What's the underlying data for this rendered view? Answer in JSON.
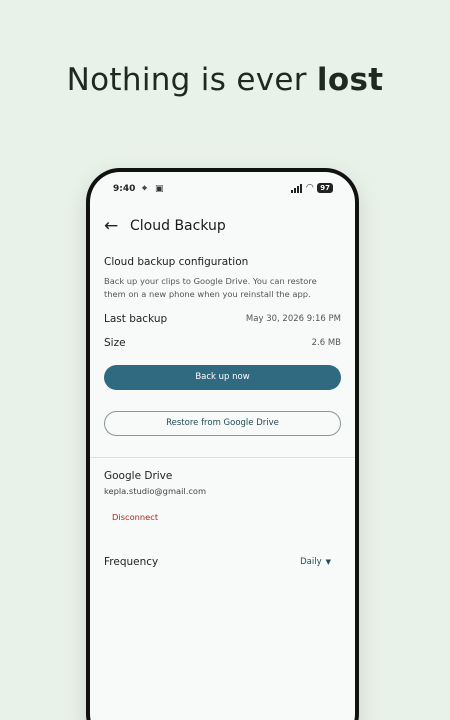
{
  "headline": {
    "prefix": "Nothing is ever ",
    "emphasis": "lost"
  },
  "status": {
    "time": "9:40",
    "battery": "97",
    "left_icons": [
      "navigation-icon",
      "sim-icon"
    ],
    "right_icons": [
      "signal-icon",
      "wifi-icon",
      "battery-icon"
    ]
  },
  "appbar": {
    "title": "Cloud Backup",
    "back_icon": "arrow-left-icon"
  },
  "config": {
    "title": "Cloud backup configuration",
    "description": "Back up your clips to Google Drive. You can restore them on a new phone when you reinstall the app."
  },
  "last_backup": {
    "label": "Last backup",
    "value": "May 30, 2026 9:16 PM"
  },
  "size": {
    "label": "Size",
    "value": "2.6 MB"
  },
  "buttons": {
    "backup": "Back up now",
    "restore": "Restore from Google Drive"
  },
  "drive": {
    "title": "Google Drive",
    "email": "kepla.studio@gmail.com",
    "disconnect": "Disconnect"
  },
  "frequency": {
    "label": "Frequency",
    "value": "Daily"
  },
  "colors": {
    "background": "#e9f2e9",
    "primary": "#2f6a80",
    "danger": "#a12820"
  }
}
